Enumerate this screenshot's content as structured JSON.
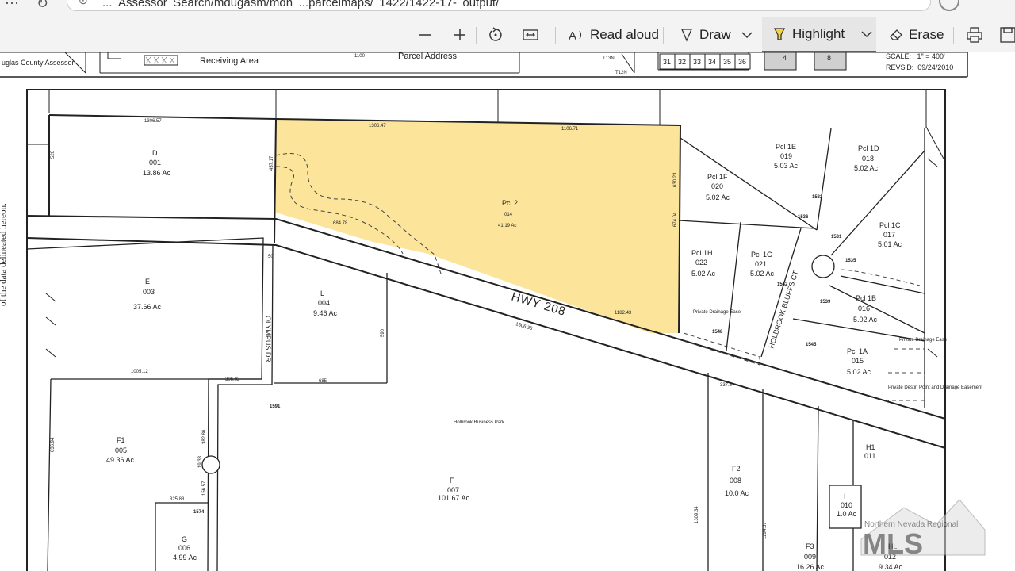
{
  "browser": {
    "url": "... Assessor Search/mdugasm/mdn ...parcelmaps/ 1422/1422-17- output/"
  },
  "toolbar": {
    "read_aloud": "Read aloud",
    "draw": "Draw",
    "highlight": "Highlight",
    "erase": "Erase"
  },
  "header": {
    "assessor": "uglas County Assessor",
    "receiving_area": "Receiving Area",
    "parcel_address": "Parcel Address",
    "address_code": "1100",
    "sections": [
      "31",
      "32",
      "33",
      "34",
      "35",
      "36"
    ],
    "range_boxes": [
      "4",
      "8"
    ],
    "scale": "SCALE:   1\" = 400'",
    "revised": "REVS'D:  09/24/2010",
    "t13n": "T13N",
    "t12n": "T12N"
  },
  "map": {
    "side_note": "of the data delineated hereon.",
    "road_hwy": "HWY 208",
    "road_olympus": "OLYMPUS DR",
    "road_holbrook": "HOLBROOK BLUFFS CT",
    "business_park": "Holbrook Business Park",
    "parcels": {
      "d": {
        "name": "D",
        "num": "001",
        "area": "13.86 Ac"
      },
      "pcl2": {
        "name": "Pcl 2",
        "num": "014",
        "area": "41.19 Ac"
      },
      "e": {
        "name": "E",
        "num": "003",
        "area": "37.66 Ac"
      },
      "l": {
        "name": "L",
        "num": "004",
        "area": "9.46 Ac"
      },
      "f1": {
        "name": "F1",
        "num": "005",
        "area": "49.36 Ac"
      },
      "f": {
        "name": "F",
        "num": "007",
        "area": "101.67 Ac"
      },
      "g": {
        "name": "G",
        "num": "006",
        "area": "4.99 Ac"
      },
      "pcl1f": {
        "name": "Pcl 1F",
        "num": "020",
        "area": "5.02 Ac"
      },
      "pcl1e": {
        "name": "Pcl 1E",
        "num": "019",
        "area": "5.03 Ac"
      },
      "pcl1d": {
        "name": "Pcl 1D",
        "num": "018",
        "area": "5.02 Ac"
      },
      "pcl1c": {
        "name": "Pcl 1C",
        "num": "017",
        "area": "5.01 Ac"
      },
      "pcl1h": {
        "name": "Pcl 1H",
        "num": "022",
        "area": "5.02 Ac"
      },
      "pcl1g": {
        "name": "Pcl 1G",
        "num": "021",
        "area": "5.02 Ac"
      },
      "pcl1b": {
        "name": "Pcl 1B",
        "num": "016",
        "area": "5.02 Ac"
      },
      "pcl1a": {
        "name": "Pcl 1A",
        "num": "015",
        "area": "5.02 Ac"
      },
      "f2": {
        "name": "F2",
        "num": "008",
        "area": "10.0 Ac"
      },
      "f3": {
        "name": "F3",
        "num": "009",
        "area": "16.26 Ac"
      },
      "i": {
        "name": "I",
        "num": "010",
        "area": "1.0 Ac"
      },
      "h1": {
        "name": "H1",
        "num": "011",
        "area": ""
      },
      "hl": {
        "name": "HL",
        "num": "012",
        "area": "9.34 Ac"
      }
    },
    "addresses": [
      "1591",
      "1574",
      "1548",
      "1542",
      "1545",
      "1539",
      "1535",
      "1531",
      "1532",
      "1536"
    ],
    "dims": {
      "d_top": "1306.57",
      "pcl2_top": "1306.47",
      "pcl2_top2": "1106.71",
      "pcl2_left": "457.17",
      "pcl2_right": "630.23",
      "pcl2_right2": "674.04",
      "e_left": "636.94",
      "pcl2_road": "684.78",
      "hwy_bottom": "1182.43",
      "f_top": "1506.35",
      "e_bottom": "1005.12",
      "olympus_306": "306.02",
      "l_bottom": "685",
      "l_right": "590",
      "olympus_50": "50",
      "d_left": "520",
      "f_left": "382.86",
      "f_left2": "19.33",
      "f_left3": "156.57",
      "g_top": "325.88",
      "f2_right": "1309.34",
      "f2_right2": "1294.87",
      "f2_top": "337.5"
    },
    "notes": {
      "private_drainage": "Private Drainage Ease",
      "private_drainage2": "Private Drainage Ease",
      "private_destin": "Private Destin Point and Drainage Easement"
    }
  },
  "watermark": {
    "line1": "Northern Nevada Regional",
    "line2": "MLS"
  },
  "colors": {
    "highlight": "#fbe08a",
    "accent": "#2b62d8",
    "toolbar_bg": "#f3f3f3"
  }
}
